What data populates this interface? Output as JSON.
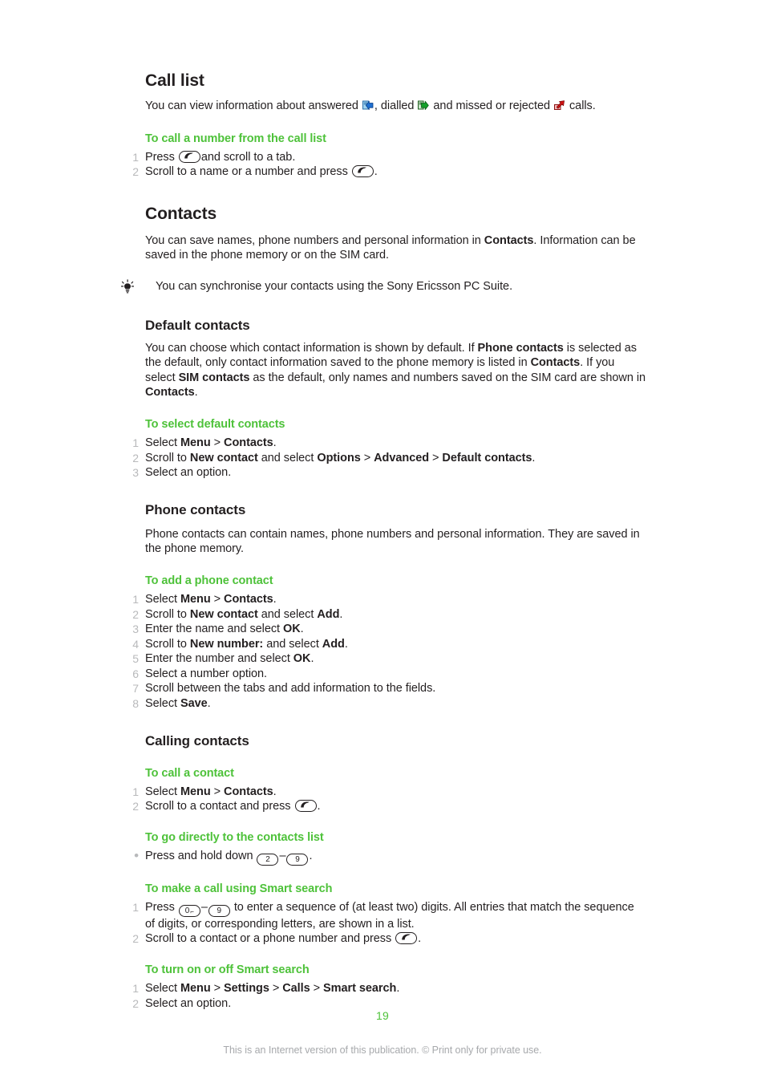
{
  "page": {
    "number": "19",
    "footnote": "This is an Internet version of this publication. © Print only for private use."
  },
  "sections": {
    "call_list": {
      "heading": "Call list",
      "intro_a": "You can view information about answered",
      "intro_b": ", dialled",
      "intro_c": "and missed or rejected",
      "intro_d": "calls.",
      "procedure": {
        "title": "To call a number from the call list",
        "steps": [
          {
            "num": "1",
            "a": "Press",
            "b": "and scroll to a tab."
          },
          {
            "num": "2",
            "a": "Scroll to a name or a number and press",
            "b": "."
          }
        ]
      }
    },
    "contacts": {
      "heading": "Contacts",
      "intro_a": "You can save names, phone numbers and personal information in ",
      "intro_bold1": "Contacts",
      "intro_b": ". Information can be saved in the phone memory or on the SIM card.",
      "tip": "You can synchronise your contacts using the Sony Ericsson PC Suite."
    },
    "default_contacts": {
      "heading": "Default contacts",
      "para": [
        "You can choose which contact information is shown by default. If ",
        "Phone contacts",
        " is selected as the default, only contact information saved to the phone memory is listed in ",
        "Contacts",
        ". If you select ",
        "SIM contacts",
        " as the default, only names and numbers saved on the SIM card are shown in ",
        "Contacts",
        "."
      ],
      "procedure": {
        "title": "To select default contacts",
        "steps": [
          {
            "num": "1",
            "parts": [
              "Select ",
              "Menu",
              " > ",
              "Contacts",
              "."
            ]
          },
          {
            "num": "2",
            "parts": [
              "Scroll to ",
              "New contact",
              " and select ",
              "Options",
              " > ",
              "Advanced",
              " > ",
              "Default contacts",
              "."
            ]
          },
          {
            "num": "3",
            "parts": [
              "Select an option."
            ]
          }
        ]
      }
    },
    "phone_contacts": {
      "heading": "Phone contacts",
      "para": "Phone contacts can contain names, phone numbers and personal information. They are saved in the phone memory.",
      "procedure": {
        "title": "To add a phone contact",
        "steps": [
          {
            "num": "1",
            "parts": [
              "Select ",
              "Menu",
              " > ",
              "Contacts",
              "."
            ]
          },
          {
            "num": "2",
            "parts": [
              "Scroll to ",
              "New contact",
              " and select ",
              "Add",
              "."
            ]
          },
          {
            "num": "3",
            "parts": [
              "Enter the name and select ",
              "OK",
              "."
            ]
          },
          {
            "num": "4",
            "parts": [
              "Scroll to ",
              "New number:",
              " and select ",
              "Add",
              "."
            ]
          },
          {
            "num": "5",
            "parts": [
              "Enter the number and select ",
              "OK",
              "."
            ]
          },
          {
            "num": "6",
            "parts": [
              "Select a number option."
            ]
          },
          {
            "num": "7",
            "parts": [
              "Scroll between the tabs and add information to the fields."
            ]
          },
          {
            "num": "8",
            "parts": [
              "Select ",
              "Save",
              "."
            ]
          }
        ]
      }
    },
    "calling_contacts": {
      "heading": "Calling contacts",
      "proc_call": {
        "title": "To call a contact",
        "step1": {
          "num": "1",
          "a": "Select ",
          "bold1": "Menu",
          "b": " > ",
          "bold2": "Contacts",
          "c": "."
        },
        "step2": {
          "num": "2",
          "a": "Scroll to a contact and press",
          "b": "."
        }
      },
      "proc_direct": {
        "title": "To go directly to the contacts list",
        "bullet": "•",
        "a": "Press and hold down",
        "key_from": "2",
        "dash": "–",
        "key_to": "9",
        "b": "."
      },
      "proc_smart_call": {
        "title": "To make a call using Smart search",
        "step1": {
          "num": "1",
          "a": "Press",
          "key_from": "0",
          "dash": "–",
          "key_to": "9",
          "b": "to enter a sequence of (at least two) digits. All entries that match the sequence of digits, or corresponding letters, are shown in a list."
        },
        "step2": {
          "num": "2",
          "a": "Scroll to a contact or a phone number and press",
          "b": "."
        }
      },
      "proc_smart_toggle": {
        "title": "To turn on or off Smart search",
        "step1": {
          "num": "1",
          "parts": [
            "Select ",
            "Menu",
            " > ",
            "Settings",
            " > ",
            "Calls",
            " > ",
            "Smart search",
            "."
          ]
        },
        "step2": {
          "num": "2",
          "parts": [
            "Select an option."
          ]
        }
      }
    }
  },
  "icons": {
    "answered": "answered-call-icon",
    "dialled": "dialled-call-icon",
    "missed": "missed-call-icon",
    "tip": "lightbulb-tip-icon",
    "call_key": "call-key-icon"
  },
  "colors": {
    "accent_green": "#4ec23a",
    "text": "#231f20",
    "marker_gray": "#b8b9bb",
    "footnote_gray": "#a7a9ac"
  }
}
